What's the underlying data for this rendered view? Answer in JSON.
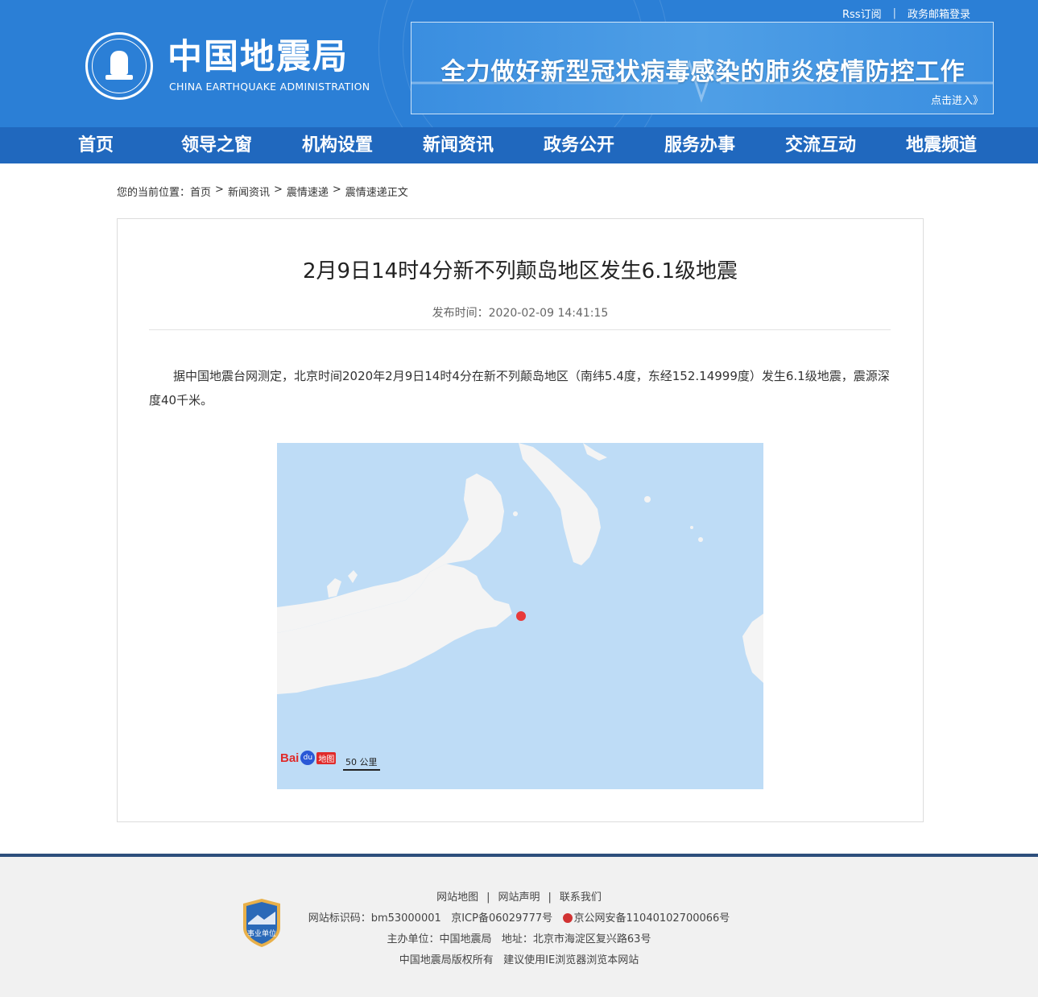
{
  "top_links": {
    "rss": "Rss订阅",
    "separator": "|",
    "mail": "政务邮箱登录"
  },
  "site": {
    "title": "中国地震局",
    "subtitle": "CHINA EARTHQUAKE ADMINISTRATION"
  },
  "banner": {
    "text": "全力做好新型冠状病毒感染的肺炎疫情防控工作",
    "link": "点击进入》"
  },
  "nav": {
    "items": [
      "首页",
      "领导之窗",
      "机构设置",
      "新闻资讯",
      "政务公开",
      "服务办事",
      "交流互动",
      "地震频道"
    ]
  },
  "breadcrumb": {
    "prefix": "您的当前位置：",
    "items": [
      "首页",
      "新闻资讯",
      "震情速递",
      "震情速递正文"
    ],
    "separator": ">"
  },
  "article": {
    "title": "2月9日14时4分新不列颠岛地区发生6.1级地震",
    "meta": "发布时间：2020-02-09 14:41:15",
    "body": "据中国地震台网测定，北京时间2020年2月9日14时4分在新不列颠岛地区（南纬5.4度，东经152.14999度）发生6.1级地震，震源深度40千米。"
  },
  "map": {
    "logo_bai": "Bai",
    "logo_du": "du",
    "logo_ditu": "地图",
    "scale": "50 公里",
    "water_color": "#bedcf6",
    "land_color": "#f4f4f4",
    "marker_color": "#e83a3a"
  },
  "footer": {
    "links": [
      "网站地图",
      "网站声明",
      "联系我们"
    ],
    "link_sep": "|",
    "line2_a": "网站标识码：bm53000001",
    "line2_b": "京ICP备06029777号",
    "line2_c": "京公网安备11040102700066号",
    "line3": "主办单位：中国地震局   地址：北京市海淀区复兴路63号",
    "line4": "中国地震局版权所有   建议使用IE浏览器浏览本网站",
    "badge": "事业单位"
  },
  "colors": {
    "header": "#2b7fd6",
    "nav": "#2068be",
    "footer_border": "#2d4f7c"
  }
}
